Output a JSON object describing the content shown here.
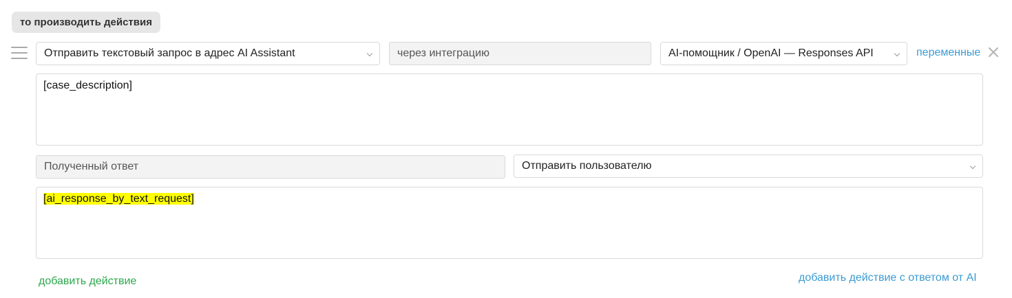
{
  "section": {
    "title": "то производить действия"
  },
  "action": {
    "type_select": "Отправить текстовый запрос в адрес AI Assistant",
    "via_field": "через интеграцию",
    "integration_select": "AI-помощник / OpenAI — Responses API",
    "variables_link": "переменные",
    "remove_icon": "close-icon",
    "request_text": "[case_description]",
    "response_label": "Полученный ответ",
    "response_target_select": "Отправить пользователю",
    "response_text": "[ai_response_by_text_request]",
    "highlight_color": "#ffff00"
  },
  "footer": {
    "add_action": "добавить действие",
    "add_action_ai": "добавить действие с ответом от AI"
  },
  "colors": {
    "link_blue": "#3a9bd5",
    "link_green": "#2aa84a",
    "badge_bg": "#e6e6e6"
  }
}
